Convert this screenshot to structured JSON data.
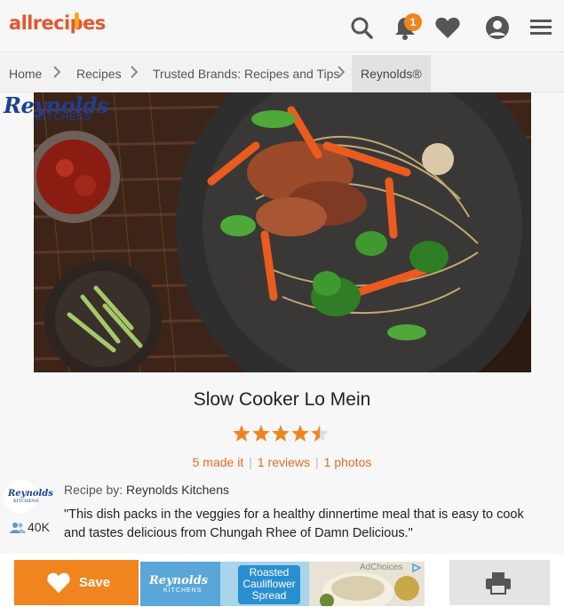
{
  "header": {
    "logo_text": "allrecipes",
    "notification_count": "1",
    "icons": [
      "search-icon",
      "bell-icon",
      "heart-icon",
      "user-icon",
      "menu-icon"
    ]
  },
  "breadcrumb": [
    "Home",
    "Recipes",
    "Trusted Brands: Recipes and Tips",
    "Reynolds®"
  ],
  "brand": {
    "logo_script": "Reynolds",
    "logo_sub": "KITCHENS"
  },
  "recipe": {
    "title": "Slow Cooker Lo Mein",
    "rating": 4.5,
    "rating_max": 5,
    "made_it": "5 made it",
    "reviews": "1 reviews",
    "photos": "1 photos",
    "author_label": "Recipe by:",
    "author_name": "Reynolds Kitchens",
    "followers": "40K",
    "description": "\"This dish packs in the veggies for a healthy dinnertime meal that is easy to cook and tastes delicious from Chungah Rhee of Damn Delicious.\""
  },
  "actions": {
    "save_label": "Save"
  },
  "ad": {
    "brand": "Reynolds",
    "brand_sub": "KITCHENS",
    "headline_lines": [
      "Roasted",
      "Cauliflower",
      "Spread"
    ],
    "adchoices": "AdChoices"
  },
  "colors": {
    "brand_orange": "#e4572e",
    "accent_orange": "#f0841f",
    "link_orange": "#e26b24",
    "reynolds_blue": "#1e3f94"
  }
}
